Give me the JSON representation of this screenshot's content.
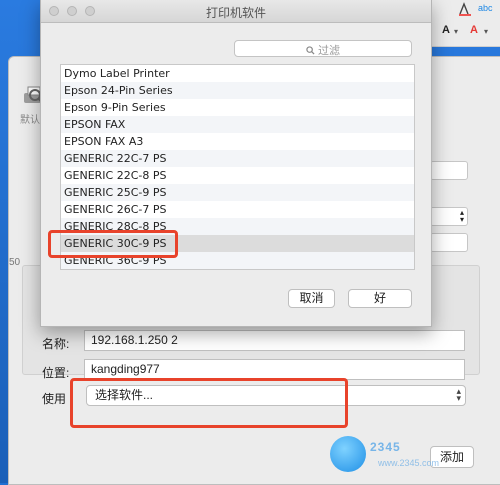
{
  "background_window": {
    "toolbar_label": "默认",
    "side_edge_text": "50",
    "name_label": "名称:",
    "name_value": "192.168.1.250 2",
    "location_label": "位置:",
    "location_value": "kangding977",
    "use_label": "使用",
    "use_select_value": "选择软件...",
    "add_button": "添加"
  },
  "word_toolbar": {
    "item1": "abc",
    "item2": "A"
  },
  "dialog": {
    "title": "打印机软件",
    "search_placeholder": "过滤",
    "printers": [
      "Dymo Label Printer",
      "Epson 24-Pin Series",
      "Epson 9-Pin Series",
      "EPSON FAX",
      "EPSON FAX A3",
      "GENERIC 22C-7 PS",
      "GENERIC 22C-8 PS",
      "GENERIC 25C-9 PS",
      "GENERIC 26C-7 PS",
      "GENERIC 28C-8 PS",
      "GENERIC 30C-9 PS",
      "GENERIC 36C-9 PS"
    ],
    "selected_index": 10,
    "cancel_button": "取消",
    "ok_button": "好"
  },
  "watermark": {
    "text": "2345",
    "sub": "www.2345.com"
  },
  "colors": {
    "highlight_box": "#e8432b",
    "desktop": "#1f6fd2"
  }
}
